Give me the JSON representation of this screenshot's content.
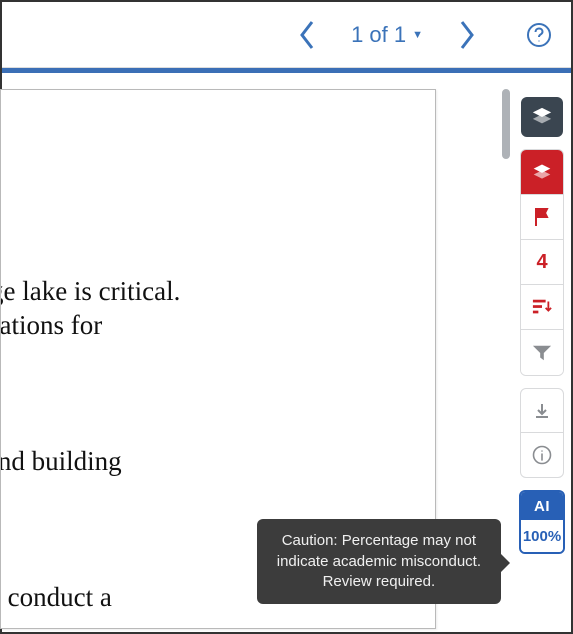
{
  "pager": {
    "label": "1 of 1"
  },
  "document": {
    "line1": "the spillway of this large lake is critical.",
    "line2": "signs outlining specifications for",
    "line3": ", carefully examining and building",
    "line4": "gy of the area, we must conduct a"
  },
  "side": {
    "flag_count": "4",
    "ai_label": "AI",
    "ai_value": "100%"
  },
  "tooltip": {
    "line1": "Caution: Percentage may not",
    "line2": "indicate academic misconduct.",
    "line3": "Review required."
  }
}
